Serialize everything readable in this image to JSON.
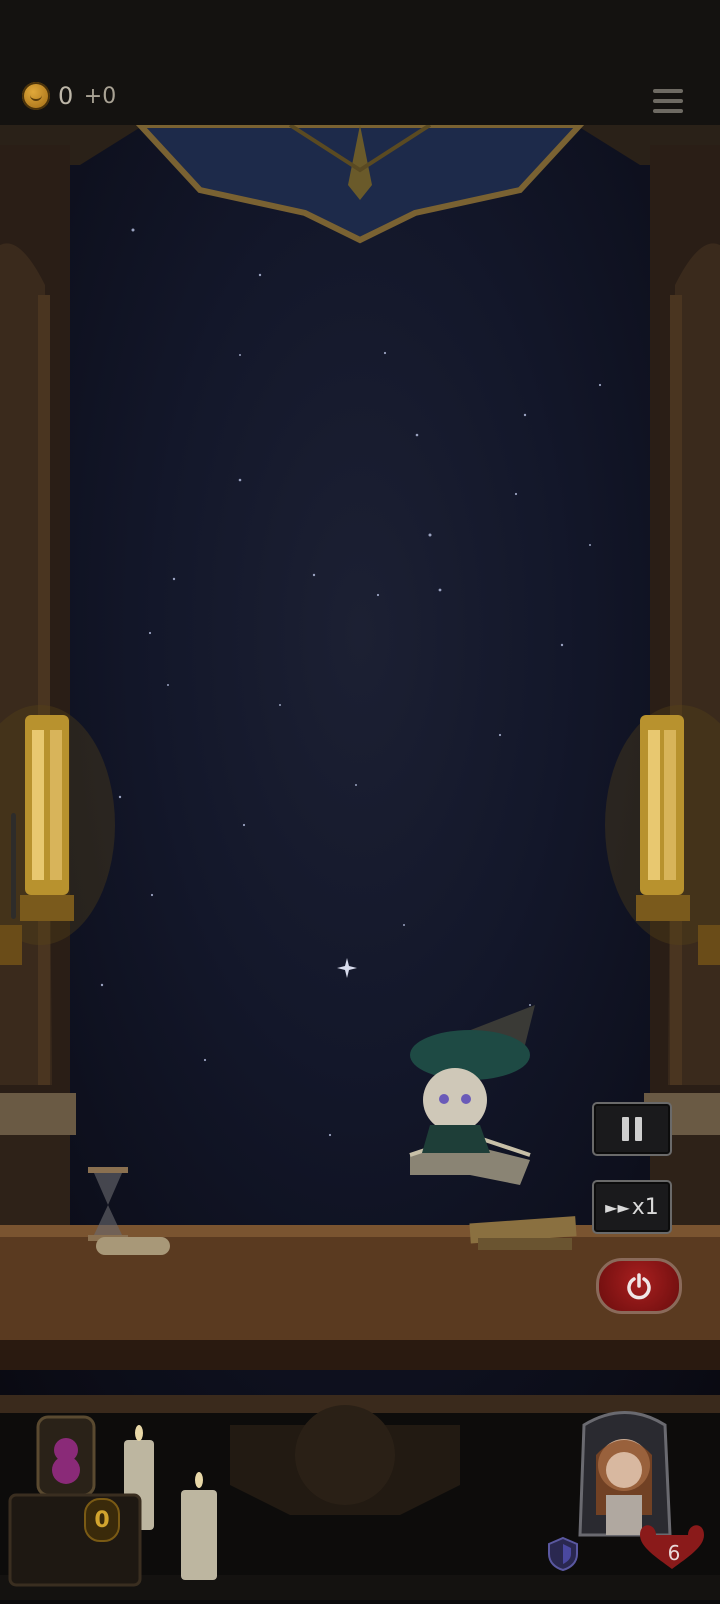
{
  "hud": {
    "coins": "0",
    "coins_delta": "+0",
    "coin_icon": "smiley-coin-icon",
    "menu_icon": "hamburger-menu-icon"
  },
  "controls": {
    "pause_icon": "pause-icon",
    "speed_label": "x1",
    "speed_icon": "fast-forward-icon",
    "power_icon": "power-icon"
  },
  "bottom": {
    "token_count": "0",
    "lives": "6",
    "shield_icon": "shield-icon",
    "pet_icon": "teddy-bear-icon",
    "avatar_icon": "princess-avatar-icon"
  },
  "colors": {
    "power_button": "#a81f1f",
    "coin": "#e0a83a",
    "sky": "#13172a",
    "wood": "#6e4526"
  }
}
